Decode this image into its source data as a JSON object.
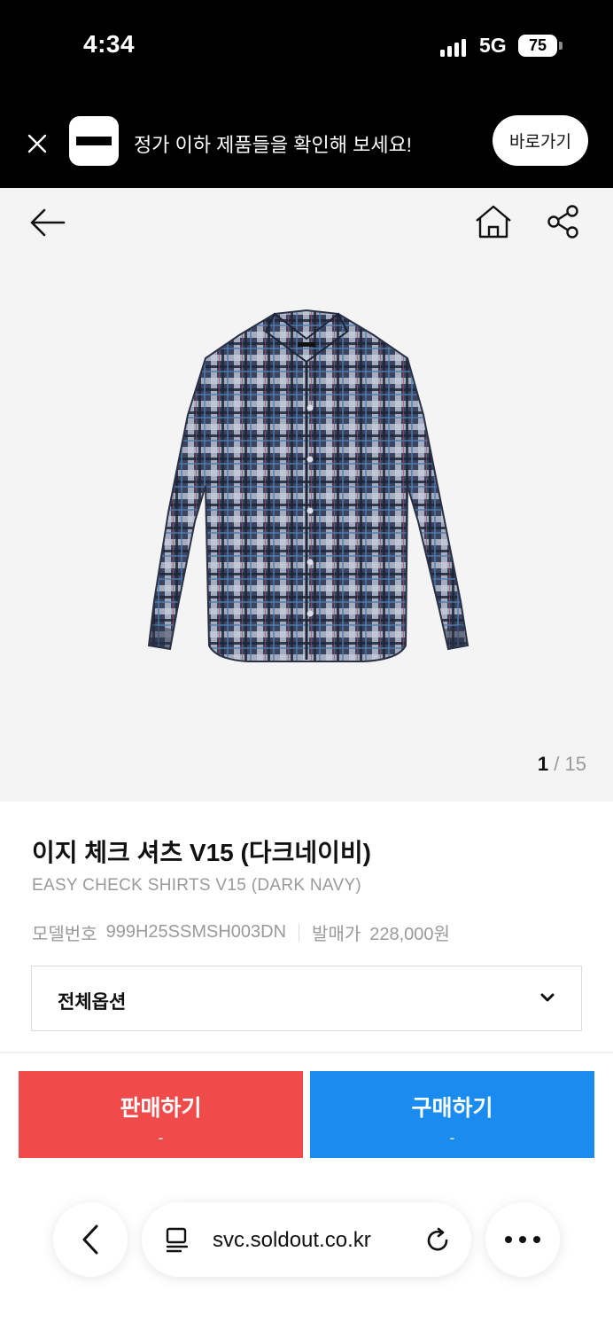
{
  "status": {
    "time": "4:34",
    "network": "5G",
    "battery": "75"
  },
  "banner": {
    "message": "정가 이하 제품들을 확인해 보세요!",
    "cta": "바로가기"
  },
  "icons": {
    "close": "close-icon",
    "back": "arrow-left-icon",
    "home": "home-icon",
    "share": "share-icon",
    "chevron": "chevron-down-icon",
    "url": "reader-icon",
    "reload": "reload-icon",
    "more": "more-icon",
    "browser_back": "chevron-left-icon"
  },
  "gallery": {
    "current": "1",
    "separator": "/",
    "total": "15"
  },
  "product": {
    "title": "이지 체크 셔츠 V15 (다크네이비)",
    "subtitle": "EASY CHECK SHIRTS V15 (DARK NAVY)",
    "model_label": "모델번호",
    "model_number": "999H25SSMSH003DN",
    "price_label": "발매가",
    "price": "228,000원"
  },
  "option": {
    "label": "전체옵션"
  },
  "actions": {
    "sell_label": "판매하기",
    "sell_price": "-",
    "buy_label": "구매하기",
    "buy_price": "-"
  },
  "browser": {
    "url": "svc.soldout.co.kr"
  },
  "colors": {
    "sell": "#ef4b4b",
    "buy": "#1a8cf0",
    "banner_bg": "#000000",
    "hero_bg": "#f4f4f4"
  }
}
